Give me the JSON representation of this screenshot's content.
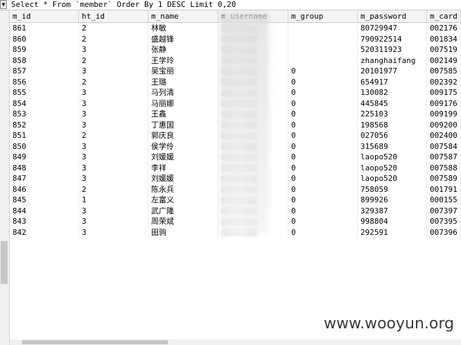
{
  "query": {
    "button_glyph": "▼",
    "text": "Select * From `member` Order By 1 DESC Limit 0,20"
  },
  "columns": [
    "m_id",
    "ht_id",
    "m_name",
    "m_username",
    "m_group",
    "m_password",
    "m_card"
  ],
  "rows": [
    {
      "m_id": "861",
      "ht_id": "2",
      "m_name": "林敏",
      "m_group": "",
      "m_password": "80729947",
      "m_card": "002176"
    },
    {
      "m_id": "860",
      "ht_id": "2",
      "m_name": "盛越锋",
      "m_group": "",
      "m_password": "790922514",
      "m_card": "001834"
    },
    {
      "m_id": "859",
      "ht_id": "3",
      "m_name": "张静",
      "m_group": "",
      "m_password": "520311923",
      "m_card": "007519"
    },
    {
      "m_id": "858",
      "ht_id": "2",
      "m_name": "王学玲",
      "m_group": "",
      "m_password": "zhanghaifang",
      "m_card": "002149"
    },
    {
      "m_id": "857",
      "ht_id": "3",
      "m_name": "吴宝丽",
      "m_group": "0",
      "m_password": "20101977",
      "m_card": "007585"
    },
    {
      "m_id": "856",
      "ht_id": "2",
      "m_name": "王璐",
      "m_group": "0",
      "m_password": "654917",
      "m_card": "002392"
    },
    {
      "m_id": "855",
      "ht_id": "3",
      "m_name": "马列清",
      "m_group": "0",
      "m_password": "130082",
      "m_card": "009175"
    },
    {
      "m_id": "854",
      "ht_id": "3",
      "m_name": "马丽娜",
      "m_group": "0",
      "m_password": "445845",
      "m_card": "009176"
    },
    {
      "m_id": "853",
      "ht_id": "3",
      "m_name": "王鑫",
      "m_group": "0",
      "m_password": "225103",
      "m_card": "009199"
    },
    {
      "m_id": "852",
      "ht_id": "3",
      "m_name": "丁惠国",
      "m_group": "0",
      "m_password": "198568",
      "m_card": "009200"
    },
    {
      "m_id": "851",
      "ht_id": "2",
      "m_name": "郭庆良",
      "m_group": "0",
      "m_password": "027056",
      "m_card": "002400"
    },
    {
      "m_id": "850",
      "ht_id": "3",
      "m_name": "侯学伶",
      "m_group": "0",
      "m_password": "315689",
      "m_card": "007584"
    },
    {
      "m_id": "849",
      "ht_id": "3",
      "m_name": "刘媛媛",
      "m_group": "0",
      "m_password": "laopo520",
      "m_card": "007587"
    },
    {
      "m_id": "848",
      "ht_id": "3",
      "m_name": "李祥",
      "m_group": "0",
      "m_password": "laopo520",
      "m_card": "007588"
    },
    {
      "m_id": "847",
      "ht_id": "3",
      "m_name": "刘媛媛",
      "m_group": "0",
      "m_password": "laopo520",
      "m_card": "007589"
    },
    {
      "m_id": "846",
      "ht_id": "2",
      "m_name": "陈永兵",
      "m_group": "0",
      "m_password": "758059",
      "m_card": "001791"
    },
    {
      "m_id": "845",
      "ht_id": "1",
      "m_name": "左富义",
      "m_group": "0",
      "m_password": "899926",
      "m_card": "000155"
    },
    {
      "m_id": "844",
      "ht_id": "3",
      "m_name": "武广隆",
      "m_group": "0",
      "m_password": "329387",
      "m_card": "007397"
    },
    {
      "m_id": "843",
      "ht_id": "3",
      "m_name": "周荣斌",
      "m_group": "0",
      "m_password": "998804",
      "m_card": "007395"
    },
    {
      "m_id": "842",
      "ht_id": "3",
      "m_name": "田驹",
      "m_group": "0",
      "m_password": "292591",
      "m_card": "007396"
    }
  ],
  "watermark": "www.wooyun.org"
}
